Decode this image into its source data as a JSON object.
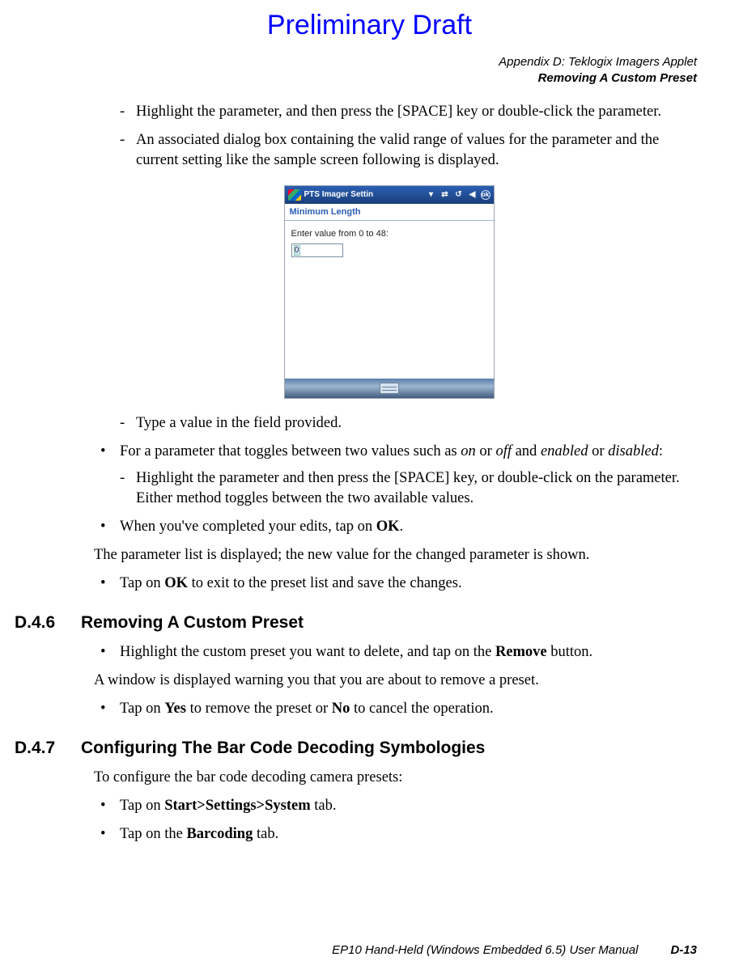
{
  "draft": "Preliminary Draft",
  "appendix": {
    "line1": "Appendix D:  Teklogix Imagers Applet",
    "line2": "Removing A Custom Preset"
  },
  "intro": {
    "dash1": "Highlight the parameter, and then press the [SPACE] key or double-click the parameter.",
    "dash2": "An associated dialog box containing the valid range of values for the parameter and the current setting like the sample screen following is displayed."
  },
  "dialog": {
    "title": "PTS Imager Settin",
    "ok": "ok",
    "header": "Minimum Length",
    "prompt": "Enter value from 0 to 48:",
    "value": "0"
  },
  "post": {
    "dash3": "Type a value in the field provided.",
    "b1_pre": "For a parameter that toggles between two values such as ",
    "b1_on": "on",
    "b1_mid1": " or ",
    "b1_off": "off",
    "b1_mid2": " and ",
    "b1_en": "enabled",
    "b1_mid3": " or ",
    "b1_dis": "disabled",
    "b1_end": ":",
    "nested": "Highlight the parameter and then press the [SPACE] key, or double-click on the parameter. Either method toggles between the two available values.",
    "b2_pre": "When you've completed your edits, tap on ",
    "b2_ok": "OK",
    "b2_end": ".",
    "para1": "The parameter list is displayed; the new value for the changed parameter is shown.",
    "b3_pre": "Tap on ",
    "b3_ok": "OK",
    "b3_end": " to exit to the preset list and save the changes."
  },
  "s46": {
    "num": "D.4.6",
    "title": "Removing A Custom Preset",
    "b1_pre": "Highlight the custom preset you want to delete, and tap on the ",
    "b1_rem": "Remove",
    "b1_end": " button.",
    "para": "A window is displayed warning you that you are about to remove a preset.",
    "b2_pre": "Tap on ",
    "b2_yes": "Yes",
    "b2_mid": " to remove the preset or ",
    "b2_no": "No",
    "b2_end": " to cancel the operation."
  },
  "s47": {
    "num": "D.4.7",
    "title": "Configuring The Bar Code Decoding Symbologies",
    "para": "To configure the bar code decoding camera presets:",
    "b1_pre": "Tap on ",
    "b1_path": "Start>Settings>System",
    "b1_end": " tab.",
    "b2_pre": "Tap on the ",
    "b2_bar": "Barcoding",
    "b2_end": " tab."
  },
  "footer": {
    "title": "EP10 Hand-Held (Windows Embedded 6.5) User Manual",
    "page": "D-13"
  }
}
